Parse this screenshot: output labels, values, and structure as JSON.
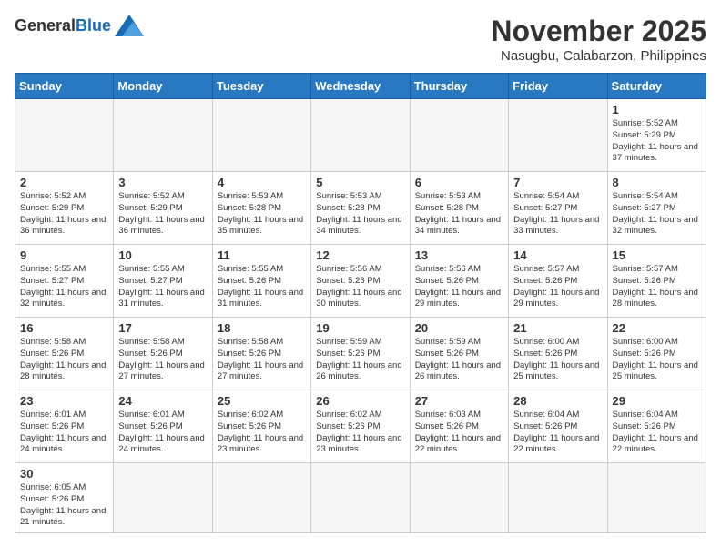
{
  "header": {
    "logo_general": "General",
    "logo_blue": "Blue",
    "month_title": "November 2025",
    "location": "Nasugbu, Calabarzon, Philippines"
  },
  "weekdays": [
    "Sunday",
    "Monday",
    "Tuesday",
    "Wednesday",
    "Thursday",
    "Friday",
    "Saturday"
  ],
  "weeks": [
    [
      {
        "day": "",
        "info": ""
      },
      {
        "day": "",
        "info": ""
      },
      {
        "day": "",
        "info": ""
      },
      {
        "day": "",
        "info": ""
      },
      {
        "day": "",
        "info": ""
      },
      {
        "day": "",
        "info": ""
      },
      {
        "day": "1",
        "info": "Sunrise: 5:52 AM\nSunset: 5:29 PM\nDaylight: 11 hours\nand 37 minutes."
      }
    ],
    [
      {
        "day": "2",
        "info": "Sunrise: 5:52 AM\nSunset: 5:29 PM\nDaylight: 11 hours\nand 36 minutes."
      },
      {
        "day": "3",
        "info": "Sunrise: 5:52 AM\nSunset: 5:29 PM\nDaylight: 11 hours\nand 36 minutes."
      },
      {
        "day": "4",
        "info": "Sunrise: 5:53 AM\nSunset: 5:28 PM\nDaylight: 11 hours\nand 35 minutes."
      },
      {
        "day": "5",
        "info": "Sunrise: 5:53 AM\nSunset: 5:28 PM\nDaylight: 11 hours\nand 34 minutes."
      },
      {
        "day": "6",
        "info": "Sunrise: 5:53 AM\nSunset: 5:28 PM\nDaylight: 11 hours\nand 34 minutes."
      },
      {
        "day": "7",
        "info": "Sunrise: 5:54 AM\nSunset: 5:27 PM\nDaylight: 11 hours\nand 33 minutes."
      },
      {
        "day": "8",
        "info": "Sunrise: 5:54 AM\nSunset: 5:27 PM\nDaylight: 11 hours\nand 32 minutes."
      }
    ],
    [
      {
        "day": "9",
        "info": "Sunrise: 5:55 AM\nSunset: 5:27 PM\nDaylight: 11 hours\nand 32 minutes."
      },
      {
        "day": "10",
        "info": "Sunrise: 5:55 AM\nSunset: 5:27 PM\nDaylight: 11 hours\nand 31 minutes."
      },
      {
        "day": "11",
        "info": "Sunrise: 5:55 AM\nSunset: 5:26 PM\nDaylight: 11 hours\nand 31 minutes."
      },
      {
        "day": "12",
        "info": "Sunrise: 5:56 AM\nSunset: 5:26 PM\nDaylight: 11 hours\nand 30 minutes."
      },
      {
        "day": "13",
        "info": "Sunrise: 5:56 AM\nSunset: 5:26 PM\nDaylight: 11 hours\nand 29 minutes."
      },
      {
        "day": "14",
        "info": "Sunrise: 5:57 AM\nSunset: 5:26 PM\nDaylight: 11 hours\nand 29 minutes."
      },
      {
        "day": "15",
        "info": "Sunrise: 5:57 AM\nSunset: 5:26 PM\nDaylight: 11 hours\nand 28 minutes."
      }
    ],
    [
      {
        "day": "16",
        "info": "Sunrise: 5:58 AM\nSunset: 5:26 PM\nDaylight: 11 hours\nand 28 minutes."
      },
      {
        "day": "17",
        "info": "Sunrise: 5:58 AM\nSunset: 5:26 PM\nDaylight: 11 hours\nand 27 minutes."
      },
      {
        "day": "18",
        "info": "Sunrise: 5:58 AM\nSunset: 5:26 PM\nDaylight: 11 hours\nand 27 minutes."
      },
      {
        "day": "19",
        "info": "Sunrise: 5:59 AM\nSunset: 5:26 PM\nDaylight: 11 hours\nand 26 minutes."
      },
      {
        "day": "20",
        "info": "Sunrise: 5:59 AM\nSunset: 5:26 PM\nDaylight: 11 hours\nand 26 minutes."
      },
      {
        "day": "21",
        "info": "Sunrise: 6:00 AM\nSunset: 5:26 PM\nDaylight: 11 hours\nand 25 minutes."
      },
      {
        "day": "22",
        "info": "Sunrise: 6:00 AM\nSunset: 5:26 PM\nDaylight: 11 hours\nand 25 minutes."
      }
    ],
    [
      {
        "day": "23",
        "info": "Sunrise: 6:01 AM\nSunset: 5:26 PM\nDaylight: 11 hours\nand 24 minutes."
      },
      {
        "day": "24",
        "info": "Sunrise: 6:01 AM\nSunset: 5:26 PM\nDaylight: 11 hours\nand 24 minutes."
      },
      {
        "day": "25",
        "info": "Sunrise: 6:02 AM\nSunset: 5:26 PM\nDaylight: 11 hours\nand 23 minutes."
      },
      {
        "day": "26",
        "info": "Sunrise: 6:02 AM\nSunset: 5:26 PM\nDaylight: 11 hours\nand 23 minutes."
      },
      {
        "day": "27",
        "info": "Sunrise: 6:03 AM\nSunset: 5:26 PM\nDaylight: 11 hours\nand 22 minutes."
      },
      {
        "day": "28",
        "info": "Sunrise: 6:04 AM\nSunset: 5:26 PM\nDaylight: 11 hours\nand 22 minutes."
      },
      {
        "day": "29",
        "info": "Sunrise: 6:04 AM\nSunset: 5:26 PM\nDaylight: 11 hours\nand 22 minutes."
      }
    ],
    [
      {
        "day": "30",
        "info": "Sunrise: 6:05 AM\nSunset: 5:26 PM\nDaylight: 11 hours\nand 21 minutes."
      },
      {
        "day": "",
        "info": ""
      },
      {
        "day": "",
        "info": ""
      },
      {
        "day": "",
        "info": ""
      },
      {
        "day": "",
        "info": ""
      },
      {
        "day": "",
        "info": ""
      },
      {
        "day": "",
        "info": ""
      }
    ]
  ]
}
